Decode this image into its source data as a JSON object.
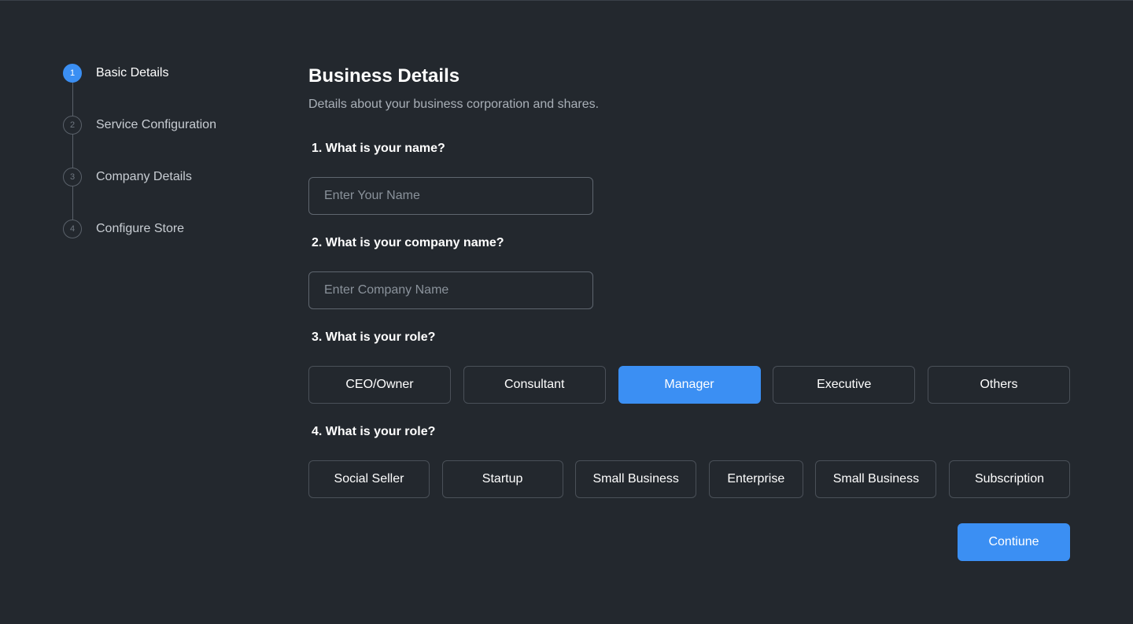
{
  "stepper": {
    "steps": [
      {
        "number": "1",
        "label": "Basic Details"
      },
      {
        "number": "2",
        "label": "Service Configuration"
      },
      {
        "number": "3",
        "label": "Company Details"
      },
      {
        "number": "4",
        "label": "Configure Store"
      }
    ],
    "active_step": "1"
  },
  "form": {
    "title": "Business Details",
    "subtitle": "Details about your business corporation and shares.",
    "q1": {
      "label": "1. What is your name?",
      "placeholder": "Enter Your Name",
      "value": ""
    },
    "q2": {
      "label": "2. What is your company name?",
      "placeholder": "Enter Company Name",
      "value": ""
    },
    "q3": {
      "label": "3. What is your role?",
      "options": [
        "CEO/Owner",
        "Consultant",
        "Manager",
        "Executive",
        "Others"
      ],
      "selected": "Manager"
    },
    "q4": {
      "label": "4. What is your role?",
      "options": [
        "Social Seller",
        "Startup",
        "Small Business",
        "Enterprise",
        "Small Business",
        "Subscription"
      ],
      "selected": ""
    },
    "continue_label": "Contiune"
  },
  "colors": {
    "background": "#23282e",
    "accent": "#3b8ff3",
    "border": "#5f666f",
    "muted_text": "#a9b0b8"
  }
}
